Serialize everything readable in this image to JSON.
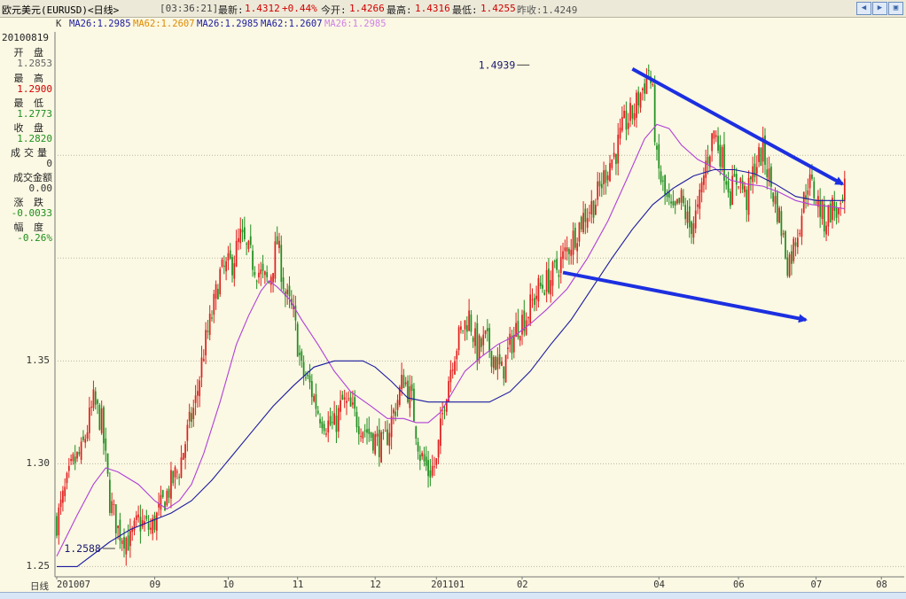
{
  "topbar": {
    "title": "欧元美元(EURUSD)<日线>",
    "time": "[03:36:21]",
    "latest_label": "最新:",
    "latest_value": "1.4312",
    "change": "+0.44%",
    "open_label": "今开:",
    "open_value": "1.4266",
    "high_label": "最高:",
    "high_value": "1.4316",
    "low_label": "最低:",
    "low_value": "1.4255",
    "prev_close": "昨收:1.4249",
    "nav_buttons": [
      "arrow-left-icon",
      "arrow-right-icon",
      "window-restore-icon"
    ]
  },
  "ma_bar": {
    "k_label": "K",
    "ma26_a": "MA26:1.2985",
    "ma62_a": "MA62:1.2607",
    "ma26_b": "MA26:1.2985",
    "ma62_b": "MA62:1.2607",
    "ma26_c": "MA26:1.2985"
  },
  "info_panel": {
    "date": "20100819",
    "open_label": "开 盘",
    "open": "1.2853",
    "high_label": "最 高",
    "high": "1.2900",
    "low_label": "最 低",
    "low": "1.2773",
    "close_label": "收 盘",
    "close": "1.2820",
    "volume_label": "成交量",
    "volume": "0",
    "amount_label": "成交金额",
    "amount": "0.00",
    "change_label": "涨 跌",
    "change": "-0.0033",
    "pct_label": "幅 度",
    "pct": "-0.26%"
  },
  "x_axis_title": "日线",
  "colors": {
    "up": "#e02020",
    "down": "#1f8f1f",
    "ma_short": "#b040d8",
    "ma_long": "#1a1aa0",
    "trend": "#1c2fe0",
    "grid": "#b9b7a6"
  },
  "chart_data": {
    "type": "candlestick",
    "y_ticks": [
      "1.25",
      "1.30",
      "1.35"
    ],
    "ylim": [
      1.245,
      1.51
    ],
    "x_ticks": [
      "201007",
      "09",
      "10",
      "11",
      "12",
      "201101",
      "02",
      "04",
      "06",
      "07",
      "08"
    ],
    "annotations": [
      {
        "text": "1.4939",
        "x_index": 229,
        "y": 1.4939
      },
      {
        "text": "1.2588",
        "x_index": 26,
        "y": 1.2588
      }
    ],
    "close_path": [
      [
        0,
        1.272
      ],
      [
        8,
        1.3
      ],
      [
        12,
        1.305
      ],
      [
        18,
        1.33
      ],
      [
        22,
        1.32
      ],
      [
        26,
        1.282
      ],
      [
        30,
        1.268
      ],
      [
        36,
        1.262
      ],
      [
        40,
        1.272
      ],
      [
        46,
        1.268
      ],
      [
        50,
        1.276
      ],
      [
        56,
        1.29
      ],
      [
        60,
        1.298
      ],
      [
        64,
        1.315
      ],
      [
        68,
        1.33
      ],
      [
        72,
        1.355
      ],
      [
        76,
        1.372
      ],
      [
        80,
        1.392
      ],
      [
        86,
        1.398
      ],
      [
        90,
        1.41
      ],
      [
        94,
        1.402
      ],
      [
        98,
        1.395
      ],
      [
        101,
        1.39
      ],
      [
        104,
        1.388
      ],
      [
        108,
        1.408
      ],
      [
        112,
        1.382
      ],
      [
        116,
        1.372
      ],
      [
        120,
        1.345
      ],
      [
        124,
        1.338
      ],
      [
        128,
        1.326
      ],
      [
        132,
        1.32
      ],
      [
        136,
        1.318
      ],
      [
        140,
        1.33
      ],
      [
        144,
        1.326
      ],
      [
        150,
        1.318
      ],
      [
        156,
        1.312
      ],
      [
        160,
        1.308
      ],
      [
        166,
        1.328
      ],
      [
        170,
        1.342
      ],
      [
        174,
        1.33
      ],
      [
        178,
        1.305
      ],
      [
        182,
        1.296
      ],
      [
        186,
        1.3
      ],
      [
        190,
        1.332
      ],
      [
        194,
        1.352
      ],
      [
        198,
        1.364
      ],
      [
        202,
        1.372
      ],
      [
        206,
        1.355
      ],
      [
        210,
        1.36
      ],
      [
        214,
        1.352
      ],
      [
        218,
        1.344
      ],
      [
        222,
        1.357
      ],
      [
        226,
        1.368
      ],
      [
        230,
        1.372
      ],
      [
        236,
        1.385
      ],
      [
        242,
        1.39
      ],
      [
        248,
        1.4
      ],
      [
        254,
        1.412
      ],
      [
        258,
        1.42
      ],
      [
        264,
        1.428
      ],
      [
        270,
        1.445
      ],
      [
        274,
        1.452
      ],
      [
        278,
        1.465
      ],
      [
        282,
        1.47
      ],
      [
        288,
        1.485
      ],
      [
        290,
        1.492
      ],
      [
        292,
        1.478
      ],
      [
        294,
        1.446
      ],
      [
        298,
        1.43
      ],
      [
        302,
        1.42
      ],
      [
        306,
        1.428
      ],
      [
        310,
        1.415
      ],
      [
        314,
        1.422
      ],
      [
        318,
        1.446
      ],
      [
        322,
        1.462
      ],
      [
        326,
        1.448
      ],
      [
        330,
        1.432
      ],
      [
        334,
        1.44
      ],
      [
        338,
        1.428
      ],
      [
        342,
        1.445
      ],
      [
        346,
        1.452
      ],
      [
        350,
        1.435
      ],
      [
        354,
        1.42
      ],
      [
        358,
        1.398
      ],
      [
        360,
        1.402
      ],
      [
        364,
        1.418
      ],
      [
        368,
        1.438
      ],
      [
        372,
        1.43
      ],
      [
        376,
        1.418
      ],
      [
        380,
        1.425
      ],
      [
        384,
        1.42
      ],
      [
        386,
        1.432
      ]
    ],
    "series": [
      {
        "name": "MA26",
        "values": [
          [
            0,
            1.255
          ],
          [
            10,
            1.275
          ],
          [
            18,
            1.29
          ],
          [
            24,
            1.298
          ],
          [
            30,
            1.296
          ],
          [
            40,
            1.29
          ],
          [
            48,
            1.282
          ],
          [
            54,
            1.278
          ],
          [
            60,
            1.282
          ],
          [
            66,
            1.29
          ],
          [
            72,
            1.305
          ],
          [
            80,
            1.33
          ],
          [
            88,
            1.358
          ],
          [
            94,
            1.372
          ],
          [
            100,
            1.384
          ],
          [
            104,
            1.389
          ],
          [
            108,
            1.386
          ],
          [
            114,
            1.38
          ],
          [
            120,
            1.37
          ],
          [
            128,
            1.358
          ],
          [
            136,
            1.345
          ],
          [
            144,
            1.335
          ],
          [
            154,
            1.328
          ],
          [
            162,
            1.322
          ],
          [
            170,
            1.322
          ],
          [
            176,
            1.32
          ],
          [
            182,
            1.32
          ],
          [
            188,
            1.325
          ],
          [
            194,
            1.335
          ],
          [
            200,
            1.345
          ],
          [
            208,
            1.352
          ],
          [
            216,
            1.358
          ],
          [
            224,
            1.362
          ],
          [
            232,
            1.368
          ],
          [
            240,
            1.375
          ],
          [
            250,
            1.385
          ],
          [
            260,
            1.4
          ],
          [
            270,
            1.418
          ],
          [
            280,
            1.44
          ],
          [
            288,
            1.458
          ],
          [
            294,
            1.465
          ],
          [
            300,
            1.463
          ],
          [
            306,
            1.455
          ],
          [
            314,
            1.448
          ],
          [
            322,
            1.444
          ],
          [
            330,
            1.438
          ],
          [
            338,
            1.436
          ],
          [
            346,
            1.435
          ],
          [
            354,
            1.432
          ],
          [
            362,
            1.428
          ],
          [
            370,
            1.426
          ],
          [
            380,
            1.425
          ],
          [
            386,
            1.424
          ]
        ]
      },
      {
        "name": "MA62",
        "values": [
          [
            0,
            1.25
          ],
          [
            10,
            1.25
          ],
          [
            18,
            1.256
          ],
          [
            26,
            1.262
          ],
          [
            36,
            1.268
          ],
          [
            46,
            1.272
          ],
          [
            56,
            1.276
          ],
          [
            66,
            1.282
          ],
          [
            76,
            1.292
          ],
          [
            86,
            1.304
          ],
          [
            96,
            1.316
          ],
          [
            106,
            1.328
          ],
          [
            116,
            1.338
          ],
          [
            126,
            1.347
          ],
          [
            136,
            1.35
          ],
          [
            144,
            1.35
          ],
          [
            150,
            1.35
          ],
          [
            156,
            1.347
          ],
          [
            164,
            1.34
          ],
          [
            172,
            1.332
          ],
          [
            182,
            1.33
          ],
          [
            192,
            1.33
          ],
          [
            202,
            1.33
          ],
          [
            212,
            1.33
          ],
          [
            222,
            1.335
          ],
          [
            232,
            1.345
          ],
          [
            242,
            1.358
          ],
          [
            252,
            1.37
          ],
          [
            262,
            1.385
          ],
          [
            272,
            1.4
          ],
          [
            282,
            1.414
          ],
          [
            292,
            1.426
          ],
          [
            302,
            1.434
          ],
          [
            312,
            1.44
          ],
          [
            322,
            1.443
          ],
          [
            332,
            1.443
          ],
          [
            342,
            1.441
          ],
          [
            352,
            1.436
          ],
          [
            362,
            1.43
          ],
          [
            372,
            1.428
          ],
          [
            386,
            1.428
          ]
        ]
      }
    ],
    "trend_lines": [
      {
        "from": [
          282,
          1.492
        ],
        "to": [
          385,
          1.436
        ]
      },
      {
        "from": [
          248,
          1.393
        ],
        "to": [
          367,
          1.37
        ]
      }
    ]
  }
}
